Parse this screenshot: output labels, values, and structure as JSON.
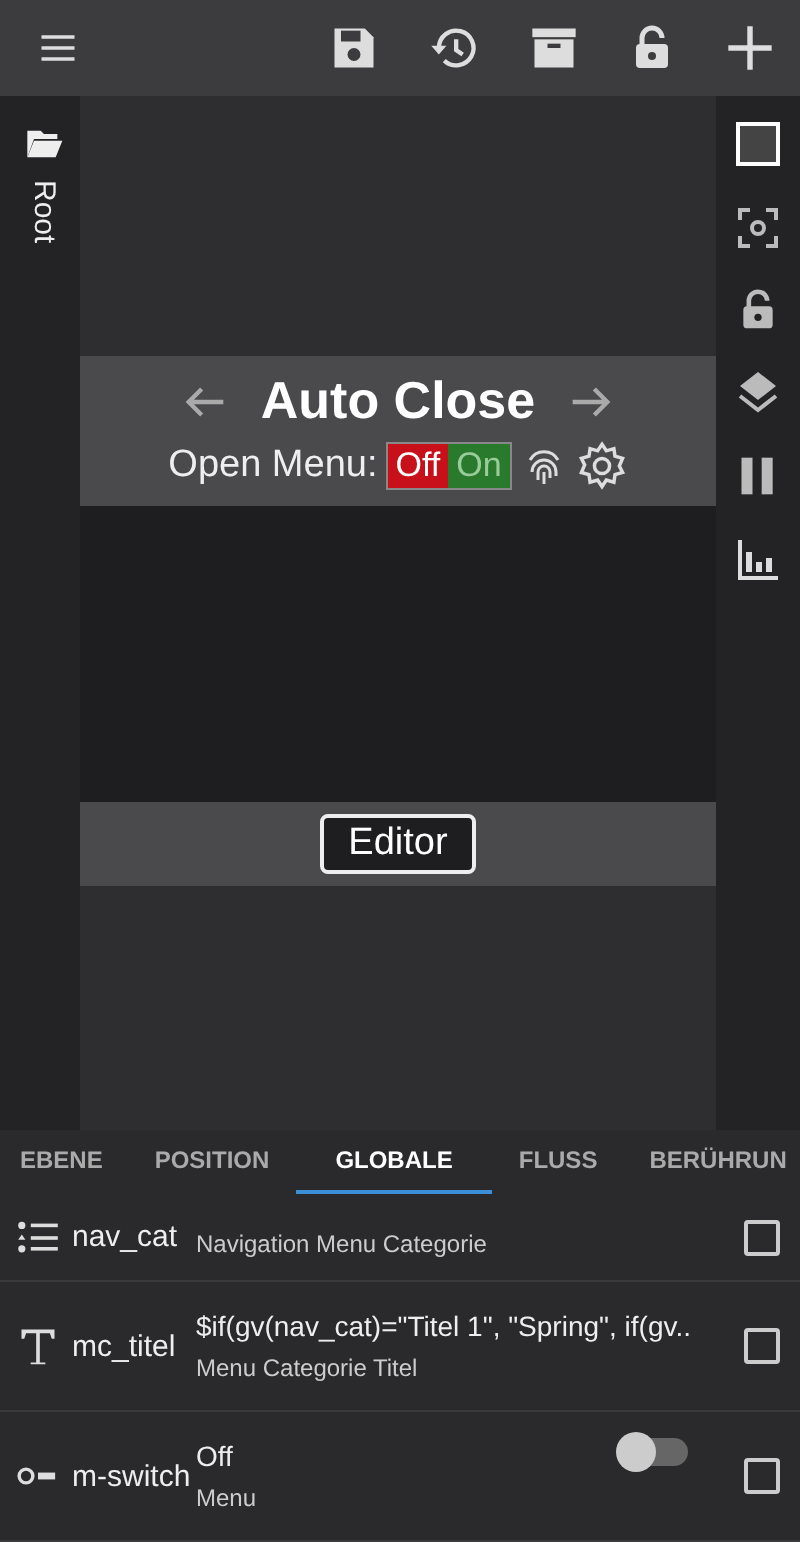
{
  "sidebar": {
    "label": "Root"
  },
  "panel": {
    "title": "Auto Close",
    "open_menu": {
      "label": "Open Menu:",
      "options": [
        {
          "label": "Off",
          "selected": true,
          "color": "#c8101a"
        },
        {
          "label": "On",
          "selected": false,
          "color": "#2a7a2e"
        }
      ]
    },
    "editor_button": "Editor"
  },
  "tabs": [
    {
      "label": "EBENE",
      "selected": false
    },
    {
      "label": "POSITION",
      "selected": false
    },
    {
      "label": "GLOBALE",
      "selected": true
    },
    {
      "label": "FLUSS",
      "selected": false
    },
    {
      "label": "BERÜHRUN",
      "selected": false
    }
  ],
  "variables": [
    {
      "kind": "list",
      "name": "nav_cat",
      "description": "Navigation Menu Categorie",
      "checked": false
    },
    {
      "kind": "text",
      "name": "mc_titel",
      "value": "$if(gv(nav_cat)=\"Titel 1\", \"Spring\", if(gv..",
      "description": "Menu Categorie Titel",
      "checked": false
    },
    {
      "kind": "switch",
      "name": "m-switch",
      "value": "Off",
      "on": false,
      "description": "Menu",
      "checked": false
    }
  ]
}
